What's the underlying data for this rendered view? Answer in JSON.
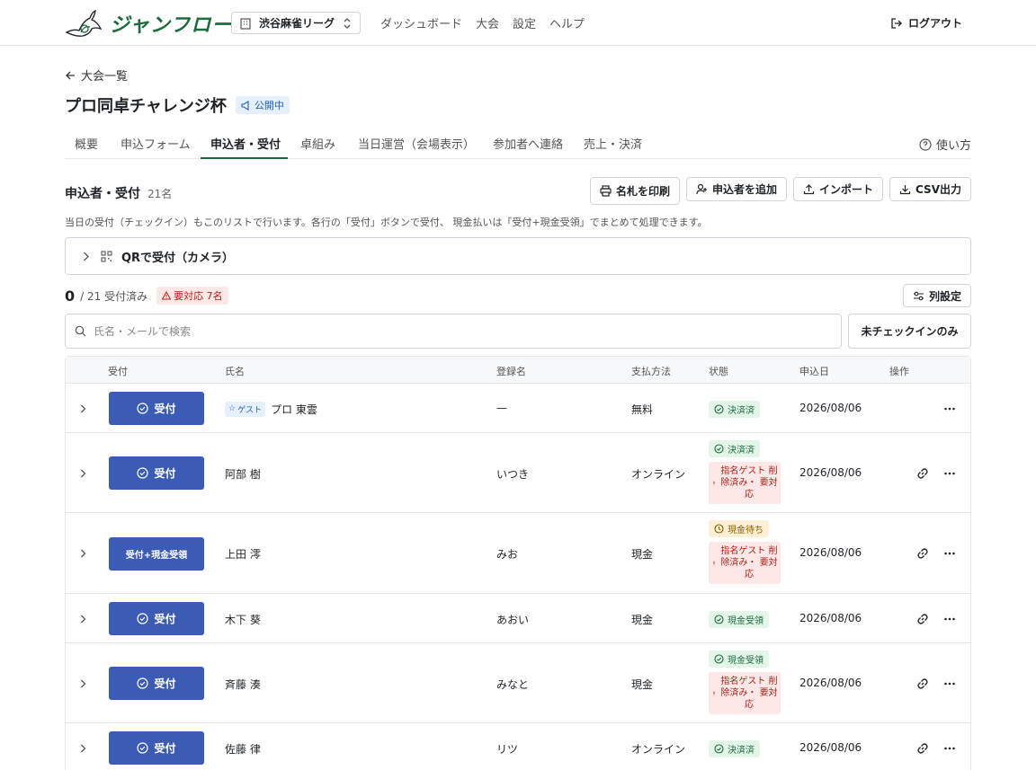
{
  "header": {
    "brand": "ジャンフロー",
    "org_select": "渋谷麻雀リーグ",
    "nav": [
      "ダッシュボード",
      "大会",
      "設定",
      "ヘルプ"
    ],
    "logout": "ログアウト"
  },
  "back_link": "大会一覧",
  "page": {
    "title": "プロ同卓チャレンジ杯",
    "status_badge": "公開中"
  },
  "tabs": [
    "概要",
    "申込フォーム",
    "申込者・受付",
    "卓組み",
    "当日運営（会場表示）",
    "参加者へ連絡",
    "売上・決済"
  ],
  "active_tab": "申込者・受付",
  "help_label": "使い方",
  "section": {
    "title": "申込者・受付",
    "count": "21名",
    "actions": {
      "print": "名札を印刷",
      "add": "申込者を追加",
      "import": "インポート",
      "csv": "CSV出力"
    },
    "hint": "当日の受付（チェックイン）もこのリストで行います。各行の「受付」ボタンで受付、 現金払いは「受付+現金受領」でまとめて処理できます。",
    "qr_label": "QRで受付（カメラ）",
    "checked_count": "0",
    "checked_total": "/ 21 受付済み",
    "alert_badge": "要対応 7名",
    "column_settings": "列設定",
    "search_placeholder": "氏名・メールで検索",
    "filter_button": "未チェックインのみ"
  },
  "table": {
    "headers": [
      "受付",
      "氏名",
      "登録名",
      "支払方法",
      "状態",
      "申込日",
      "操作"
    ],
    "rows": [
      {
        "button": "受付",
        "guest": "ゲスト",
        "name": "プロ 東雲",
        "reg": "—",
        "pay": "無料",
        "status": [
          {
            "type": "ok",
            "text": "決済済"
          }
        ],
        "date": "2026/08/06",
        "link": false
      },
      {
        "button": "受付",
        "guest": "",
        "name": "阿部 樹",
        "reg": "いつき",
        "pay": "オンライン",
        "status": [
          {
            "type": "ok",
            "text": "決済済"
          },
          {
            "type": "warn",
            "text": "指名ゲスト 削除済み・ 要対応"
          }
        ],
        "date": "2026/08/06",
        "link": true
      },
      {
        "button": "受付+現金受領",
        "guest": "",
        "name": "上田 澪",
        "reg": "みお",
        "pay": "現金",
        "status": [
          {
            "type": "wait",
            "text": "現金待ち"
          },
          {
            "type": "warn",
            "text": "指名ゲスト 削除済み・ 要対応"
          }
        ],
        "date": "2026/08/06",
        "link": true
      },
      {
        "button": "受付",
        "guest": "",
        "name": "木下 葵",
        "reg": "あおい",
        "pay": "現金",
        "status": [
          {
            "type": "ok",
            "text": "現金受領"
          }
        ],
        "date": "2026/08/06",
        "link": true
      },
      {
        "button": "受付",
        "guest": "",
        "name": "斉藤 湊",
        "reg": "みなと",
        "pay": "現金",
        "status": [
          {
            "type": "ok",
            "text": "現金受領"
          },
          {
            "type": "warn",
            "text": "指名ゲスト 削除済み・ 要対応"
          }
        ],
        "date": "2026/08/06",
        "link": true
      },
      {
        "button": "受付",
        "guest": "",
        "name": "佐藤 律",
        "reg": "リツ",
        "pay": "オンライン",
        "status": [
          {
            "type": "ok",
            "text": "決済済"
          }
        ],
        "date": "2026/08/06",
        "link": true
      }
    ]
  }
}
